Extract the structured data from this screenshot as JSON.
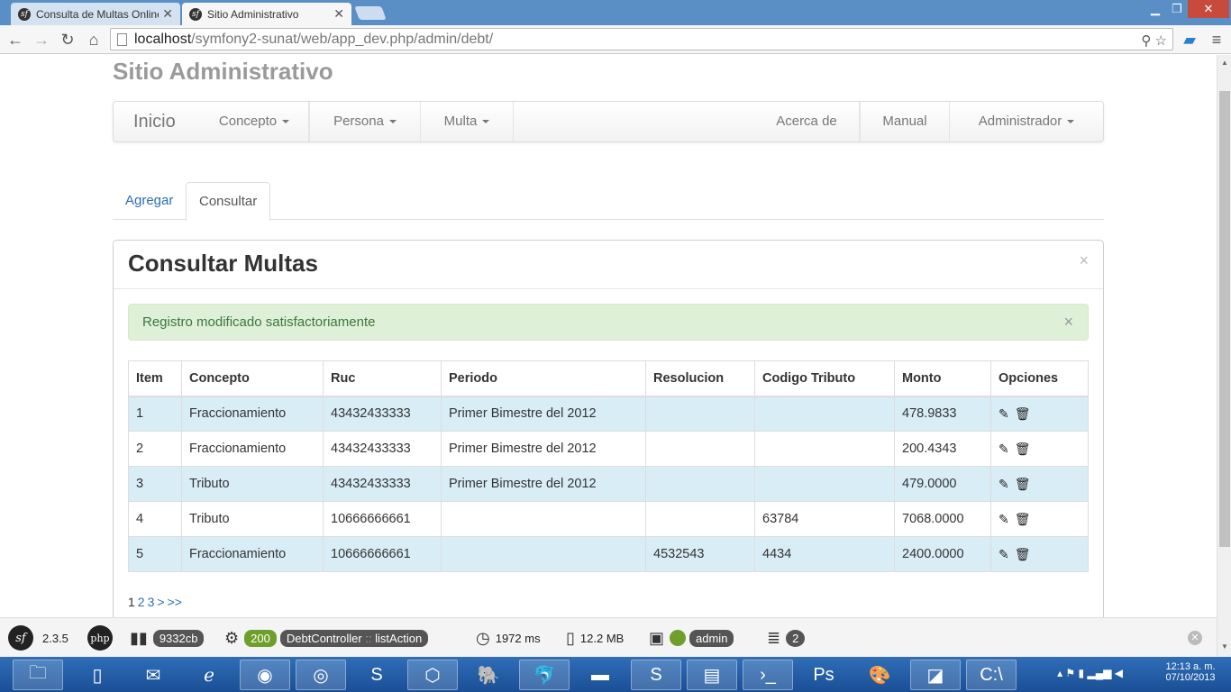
{
  "browser": {
    "tabs": [
      {
        "label": "Consulta de Multas Online",
        "active": false
      },
      {
        "label": "Sitio Administrativo",
        "active": true
      }
    ],
    "url_host": "localhost",
    "url_path": "/symfony2-sunat/web/app_dev.php/admin/debt/"
  },
  "site": {
    "title": "Sitio Administrativo",
    "brand": "Inicio",
    "nav_left": [
      "Concepto",
      "Persona",
      "Multa"
    ],
    "nav_right": [
      "Acerca de",
      "Manual",
      "Administrador"
    ]
  },
  "tabs": {
    "add": "Agregar",
    "query": "Consultar"
  },
  "panel": {
    "title": "Consultar Multas",
    "close": "×",
    "alert": "Registro modificado satisfactoriamente",
    "alert_close": "×"
  },
  "table": {
    "headers": [
      "Item",
      "Concepto",
      "Ruc",
      "Periodo",
      "Resolucion",
      "Codigo Tributo",
      "Monto",
      "Opciones"
    ],
    "rows": [
      [
        "1",
        "Fraccionamiento",
        "43432433333",
        "Primer Bimestre del 2012",
        "",
        "",
        "478.9833"
      ],
      [
        "2",
        "Fraccionamiento",
        "43432433333",
        "Primer Bimestre del 2012",
        "",
        "",
        "200.4343"
      ],
      [
        "3",
        "Tributo",
        "43432433333",
        "Primer Bimestre del 2012",
        "",
        "",
        "479.0000"
      ],
      [
        "4",
        "Tributo",
        "10666666661",
        "",
        "",
        "63784",
        "7068.0000"
      ],
      [
        "5",
        "Fraccionamiento",
        "10666666661",
        "",
        "4532543",
        "4434",
        "2400.0000"
      ]
    ]
  },
  "pager": {
    "current": "1",
    "pages": [
      "2",
      "3",
      ">",
      ">>"
    ]
  },
  "profiler": {
    "version": "2.3.5",
    "token": "9332cb",
    "status": "200",
    "controller": "DebtController",
    "separator": "::",
    "action": "listAction",
    "time": "1972 ms",
    "memory": "12.2 MB",
    "user": "admin",
    "queries": "2",
    "php_label": "php"
  },
  "tray": {
    "time": "12:13 a. m.",
    "date": "07/10/2013"
  }
}
